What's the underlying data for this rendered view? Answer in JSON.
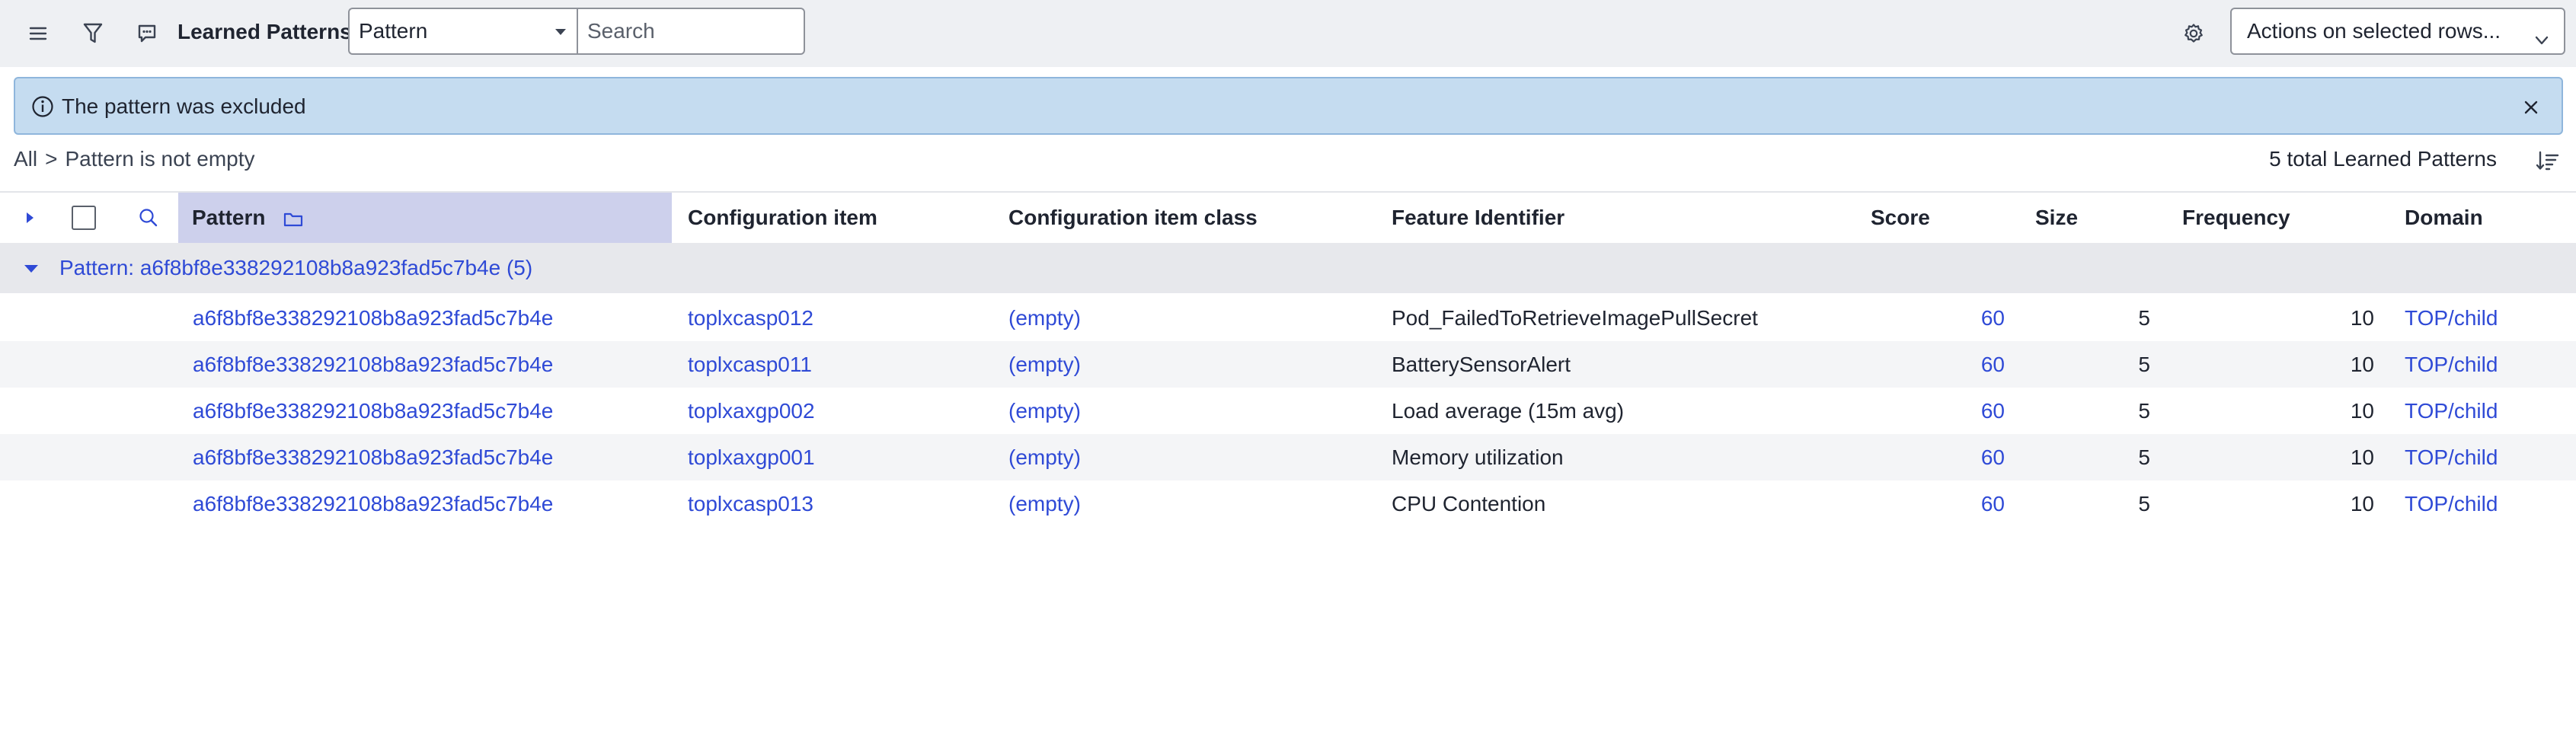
{
  "toolbar": {
    "title": "Learned Patterns",
    "field_select_value": "Pattern",
    "search_placeholder": "Search",
    "actions_label": "Actions on selected rows...",
    "icons": [
      "hamburger-menu-icon",
      "filter-icon",
      "comment-icon",
      "gear-icon",
      "chevron-down-icon"
    ]
  },
  "banner": {
    "message": "The pattern was excluded",
    "color": "#c5dcf0"
  },
  "breadcrumb": {
    "root": "All",
    "separator": ">",
    "condition": "Pattern is not empty"
  },
  "list_summary": {
    "total_text": "5 total Learned Patterns"
  },
  "table": {
    "columns": [
      "Pattern",
      "Configuration item",
      "Configuration item class",
      "Feature Identifier",
      "Score",
      "Size",
      "Frequency",
      "Domain"
    ],
    "group": {
      "label": "Pattern: a6f8bf8e338292108b8a923fad5c7b4e (5)"
    },
    "rows": [
      {
        "pattern": "a6f8bf8e338292108b8a923fad5c7b4e",
        "ci": "toplxcasp012",
        "ci_class": "(empty)",
        "feature": "Pod_FailedToRetrieveImagePullSecret",
        "score": "60",
        "size": "5",
        "frequency": "10",
        "domain": "TOP/child"
      },
      {
        "pattern": "a6f8bf8e338292108b8a923fad5c7b4e",
        "ci": "toplxcasp011",
        "ci_class": "(empty)",
        "feature": "BatterySensorAlert",
        "score": "60",
        "size": "5",
        "frequency": "10",
        "domain": "TOP/child"
      },
      {
        "pattern": "a6f8bf8e338292108b8a923fad5c7b4e",
        "ci": "toplxaxgp002",
        "ci_class": "(empty)",
        "feature": "Load average (15m avg)",
        "score": "60",
        "size": "5",
        "frequency": "10",
        "domain": "TOP/child"
      },
      {
        "pattern": "a6f8bf8e338292108b8a923fad5c7b4e",
        "ci": "toplxaxgp001",
        "ci_class": "(empty)",
        "feature": "Memory utilization",
        "score": "60",
        "size": "5",
        "frequency": "10",
        "domain": "TOP/child"
      },
      {
        "pattern": "a6f8bf8e338292108b8a923fad5c7b4e",
        "ci": "toplxcasp013",
        "ci_class": "(empty)",
        "feature": "CPU Contention",
        "score": "60",
        "size": "5",
        "frequency": "10",
        "domain": "TOP/child"
      }
    ]
  },
  "colors": {
    "link": "#2f4ad6",
    "toolbar_bg": "#eef0f3",
    "selected_column": "#cdd0ec",
    "group_bg": "#e7e8ec"
  }
}
